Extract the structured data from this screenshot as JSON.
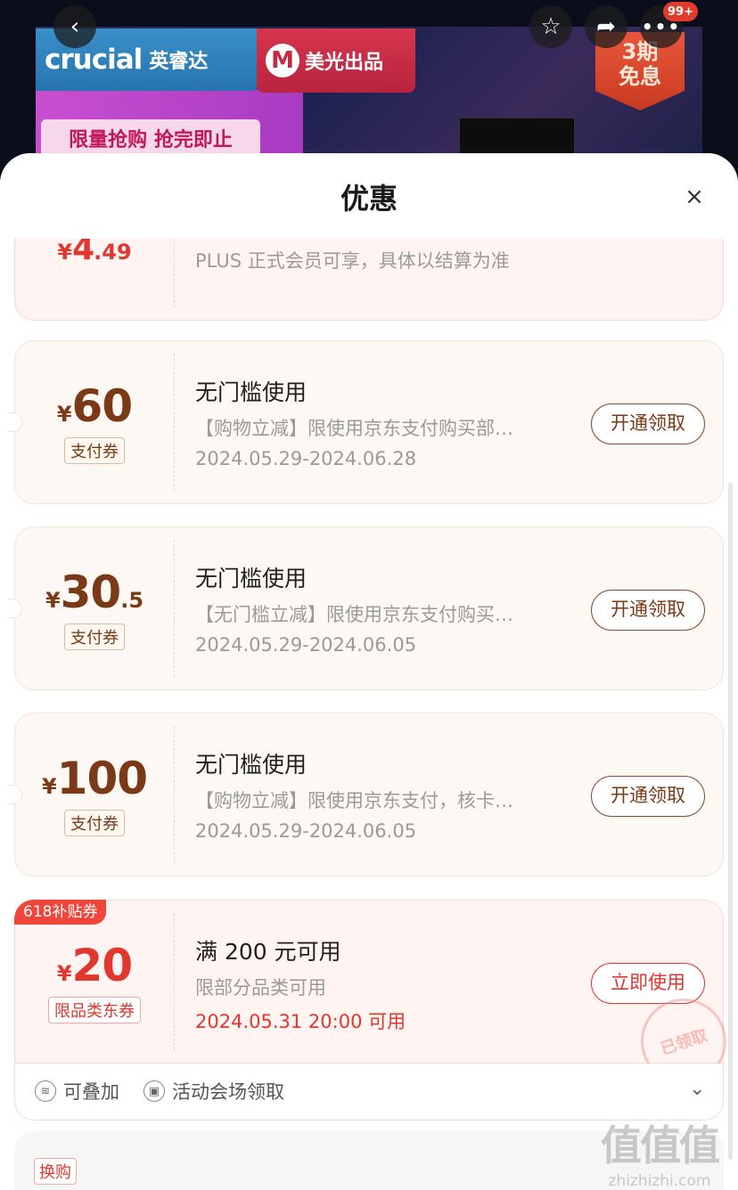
{
  "banner": {
    "brand": "crucial",
    "brand_cn": "英睿达",
    "micron_mark": "M",
    "micron_label": "美光出品",
    "promo": "限量抢购  抢完即止",
    "installment_badge": "3期\n免息",
    "notification_count": "99+"
  },
  "sheet": {
    "title": "优惠",
    "close_icon": "×"
  },
  "coupons": [
    {
      "amount_yen": "¥",
      "amount_main": "4",
      "amount_decimal": ".49",
      "type": "",
      "title": "",
      "desc": "PLUS 正式会员可享，具体以结算为准",
      "date": "",
      "button": ""
    },
    {
      "amount_yen": "¥",
      "amount_main": "60",
      "amount_decimal": "",
      "type": "支付券",
      "title": "无门槛使用",
      "desc": "【购物立减】限使用京东支付购买部…",
      "date": "2024.05.29-2024.06.28",
      "button": "开通领取"
    },
    {
      "amount_yen": "¥",
      "amount_main": "30",
      "amount_decimal": ".5",
      "type": "支付券",
      "title": "无门槛使用",
      "desc": "【无门槛立减】限使用京东支付购买…",
      "date": "2024.05.29-2024.06.05",
      "button": "开通领取"
    },
    {
      "amount_yen": "¥",
      "amount_main": "100",
      "amount_decimal": "",
      "type": "支付券",
      "title": "无门槛使用",
      "desc": "【购物立减】限使用京东支付，核卡…",
      "date": "2024.05.29-2024.06.05",
      "button": "开通领取"
    },
    {
      "tag": "618补贴券",
      "amount_yen": "¥",
      "amount_main": "20",
      "amount_decimal": "",
      "type": "限品类东券",
      "title": "满 200 元可用",
      "desc": "限部分品类可用",
      "date": "2024.05.31 20:00 可用",
      "button": "立即使用",
      "stamp": "已领取"
    }
  ],
  "footer": {
    "stackable": "可叠加",
    "venue": "活动会场领取"
  },
  "bottom": {
    "tag": "换购"
  },
  "watermark": {
    "logo": "值值值",
    "site": "zhizhizhi.com"
  }
}
